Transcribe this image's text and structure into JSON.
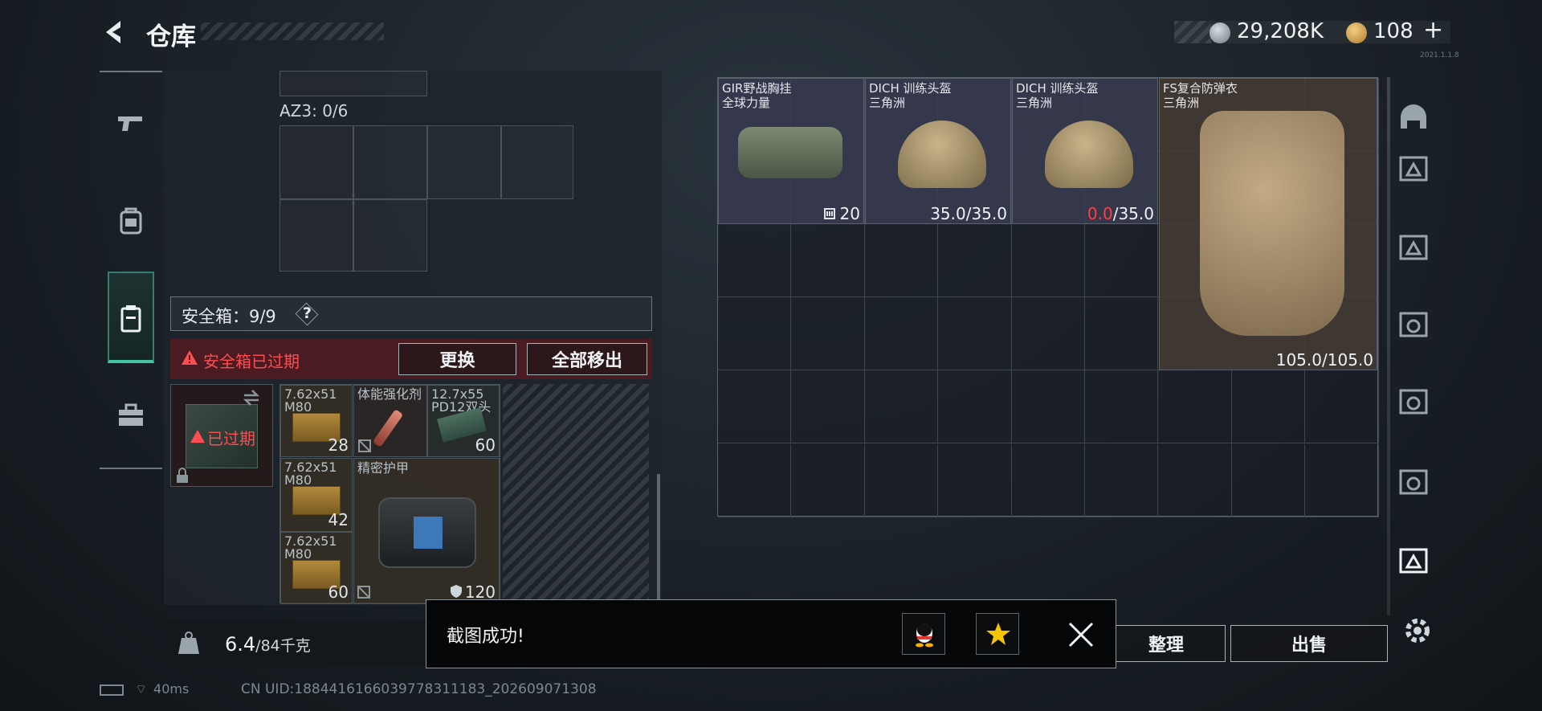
{
  "header": {
    "title": "仓库",
    "currency_1": "29,208K",
    "currency_2": "108",
    "plus": "+",
    "version": "2021.1.1.8"
  },
  "secure_box": {
    "section_label": "AZ3: 0/6",
    "safebox_label": "安全箱：9/9",
    "help": "?",
    "expired_notice": "安全箱已过期",
    "replace_button": "更换",
    "move_all_button": "全部移出",
    "case_status": "已过期",
    "items": [
      {
        "name": "7.62x51 M80",
        "count": "28"
      },
      {
        "name": "体能强化剂",
        "count": ""
      },
      {
        "name": "12.7x55 PD12双头",
        "count": "60"
      },
      {
        "name": "7.62x51 M80",
        "count": "42"
      },
      {
        "name": "精密护甲",
        "count": "120"
      },
      {
        "name": "7.62x51 M80",
        "count": "60"
      }
    ]
  },
  "storage": {
    "items": [
      {
        "name": "GIR野战胸挂",
        "sub": "全球力量",
        "stat": "20"
      },
      {
        "name": "DICH 训练头盔",
        "sub": "三角洲",
        "stat_cur": "35.0",
        "stat_max": "/35.0"
      },
      {
        "name": "DICH 训练头盔",
        "sub": "三角洲",
        "stat_cur": "0.0",
        "stat_max": "/35.0"
      },
      {
        "name": "FS复合防弹衣",
        "sub": "三角洲",
        "stat_cur": "105.0",
        "stat_max": "/105.0"
      }
    ]
  },
  "bottom": {
    "weight_value": "6.4",
    "weight_max": "/84千克",
    "tidy_button": "整理",
    "sell_button": "出售",
    "ping": "40ms",
    "uid": "CN UID:1884416166039778311183_202609071308"
  },
  "toast": {
    "message": "截图成功!"
  },
  "colors": {
    "accent": "#44c3a0",
    "warning": "#ff4b52",
    "item_bg": "#3a3c52"
  }
}
